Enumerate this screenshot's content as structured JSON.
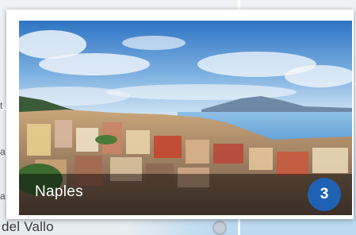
{
  "card": {
    "title": "Naples",
    "count": "3"
  },
  "map": {
    "bottom_label": "del Vallo",
    "left_labels": [
      "t",
      "a",
      "a"
    ]
  },
  "colors": {
    "badge": "#1f62b3",
    "caption_overlay": "rgba(0,0,0,0.45)",
    "sky": "#3d7fc8",
    "sea": "#6aa9d9"
  },
  "icons": {
    "photo": "naples-panorama-photo",
    "map_marker": "map-marker-icon"
  }
}
